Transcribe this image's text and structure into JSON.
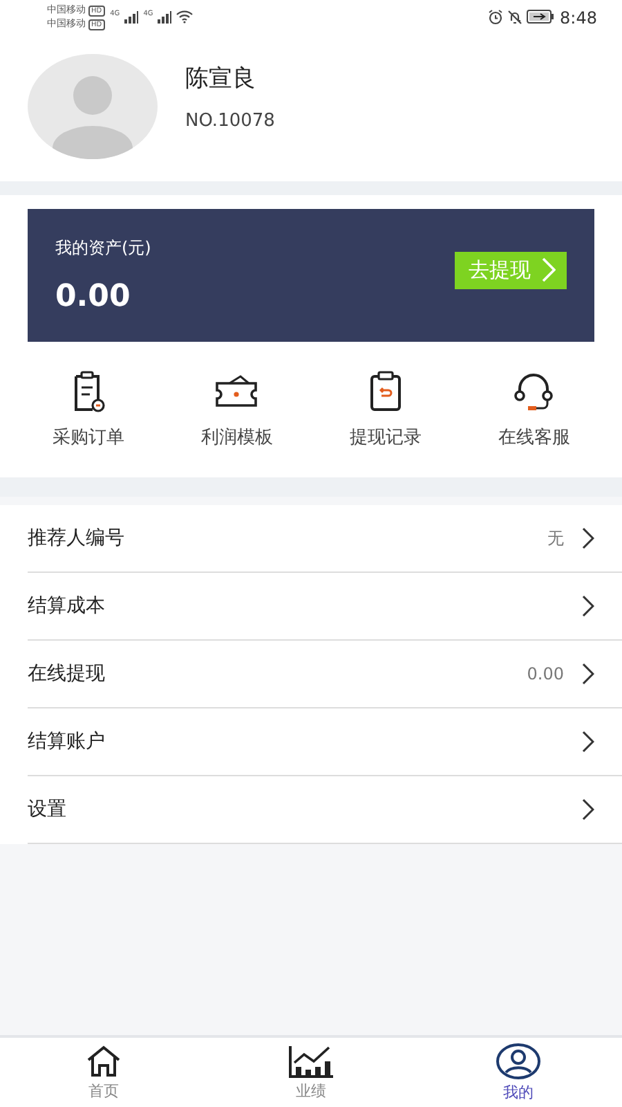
{
  "status_bar": {
    "carriers": [
      {
        "name": "中国移动",
        "badge": "HD"
      },
      {
        "name": "中国移动",
        "badge": "HD"
      }
    ],
    "networks": [
      "4G",
      "4G"
    ],
    "time": "8:48"
  },
  "profile": {
    "name": "陈宣良",
    "number": "NO.10078"
  },
  "assets": {
    "label": "我的资产(元)",
    "amount": "0.00",
    "button": "去提现"
  },
  "shortcuts": [
    {
      "kind": "order",
      "label": "采购订单"
    },
    {
      "kind": "ticket",
      "label": "利润模板"
    },
    {
      "kind": "record",
      "label": "提现记录"
    },
    {
      "kind": "service",
      "label": "在线客服"
    }
  ],
  "menu": [
    {
      "label": "推荐人编号",
      "value": "无"
    },
    {
      "label": "结算成本"
    },
    {
      "label": "在线提现",
      "value": "0.00"
    },
    {
      "label": "结算账户"
    },
    {
      "label": "设置"
    }
  ],
  "tabs": [
    {
      "kind": "home",
      "label": "首页",
      "selected": false
    },
    {
      "kind": "chart",
      "label": "业绩",
      "selected": false
    },
    {
      "kind": "user",
      "label": "我的",
      "selected": true
    }
  ]
}
